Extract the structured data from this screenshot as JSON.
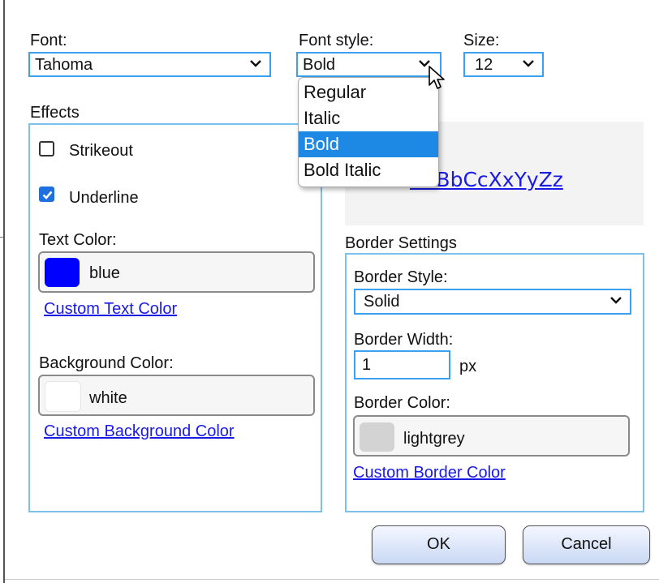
{
  "font": {
    "label": "Font:",
    "value": "Tahoma"
  },
  "font_style": {
    "label": "Font style:",
    "value": "Bold",
    "options": [
      "Regular",
      "Italic",
      "Bold",
      "Bold Italic"
    ],
    "selected_index": 2
  },
  "size": {
    "label": "Size:",
    "value": "12"
  },
  "effects": {
    "title": "Effects",
    "strikeout": {
      "label": "Strikeout",
      "checked": false
    },
    "underline": {
      "label": "Underline",
      "checked": true
    },
    "text_color": {
      "label": "Text Color:",
      "value": "blue",
      "swatch": "#0000ff",
      "link": "Custom Text Color"
    },
    "background_color": {
      "label": "Background Color:",
      "value": "white",
      "swatch": "#ffffff",
      "link": "Custom Background Color"
    }
  },
  "preview": {
    "text": "AaBbCcXxYyZz",
    "color": "#1a1ae6"
  },
  "border": {
    "title": "Border Settings",
    "style": {
      "label": "Border Style:",
      "value": "Solid"
    },
    "width": {
      "label": "Border Width:",
      "value": "1",
      "unit": "px"
    },
    "color": {
      "label": "Border Color:",
      "value": "lightgrey",
      "swatch": "#d3d3d3",
      "link": "Custom Border Color"
    }
  },
  "buttons": {
    "ok": "OK",
    "cancel": "Cancel"
  },
  "colors": {
    "accent": "#3aa0ef",
    "group_border": "#7cc0ee",
    "selection": "#1e88e5",
    "link": "#1a1ae6"
  }
}
